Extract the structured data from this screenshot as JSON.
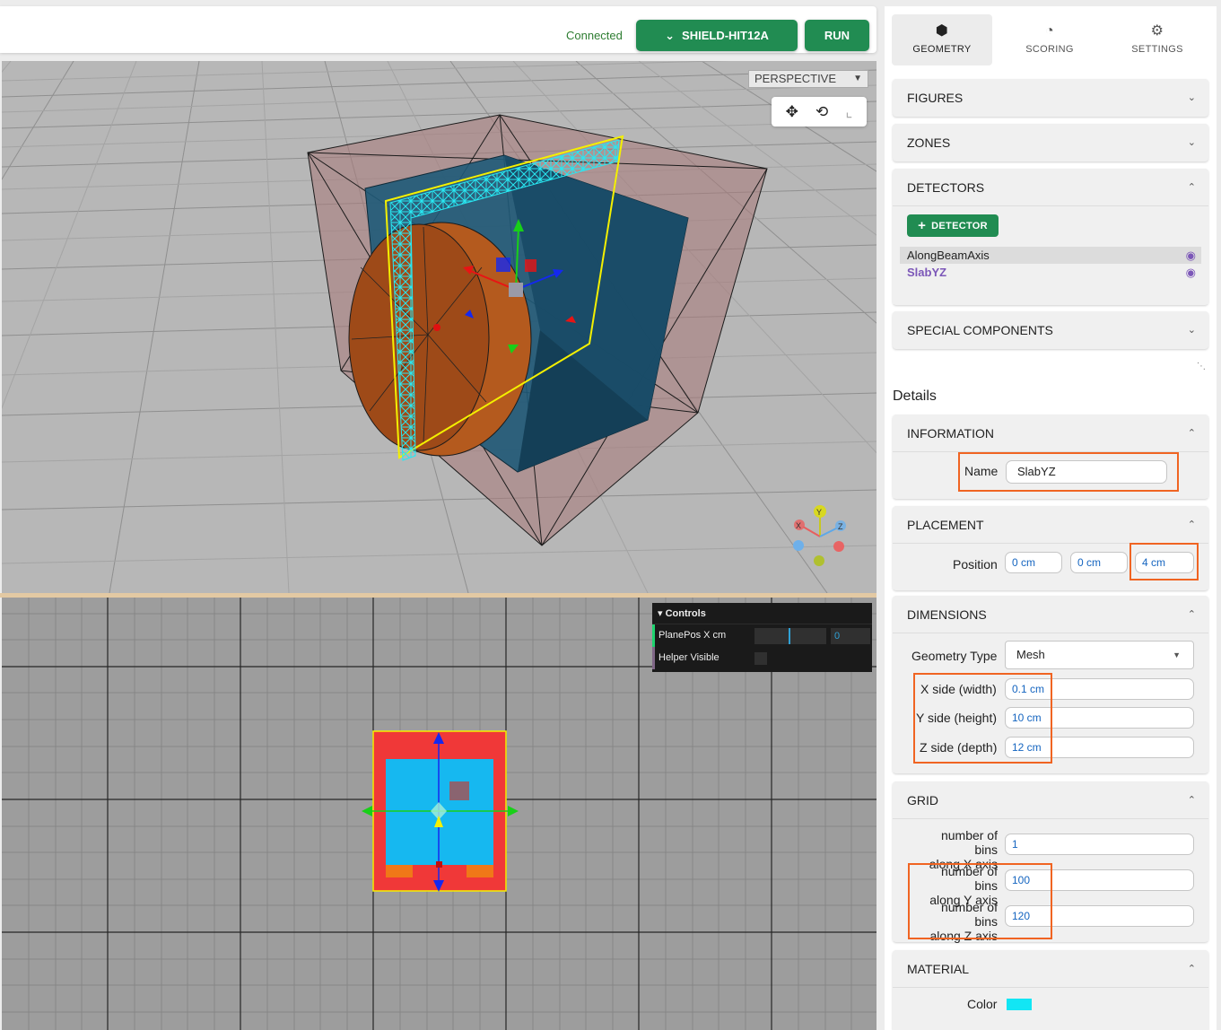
{
  "topbar": {
    "status": "Connected",
    "simulator_label": "SHIELD-HIT12A",
    "run_label": "RUN"
  },
  "viewport": {
    "camera_mode": "PERSPECTIVE",
    "axes": {
      "x": "X",
      "y": "Y",
      "z": "Z"
    }
  },
  "controls": {
    "title": "Controls",
    "plane_pos_label": "PlanePos X cm",
    "plane_pos_value": "0",
    "helper_visible_label": "Helper Visible"
  },
  "tabs": [
    {
      "label": "GEOMETRY",
      "icon": "cube-icon"
    },
    {
      "label": "SCORING",
      "icon": "speedometer-icon"
    },
    {
      "label": "SETTINGS",
      "icon": "gear-icon"
    }
  ],
  "sections": {
    "figures": "FIGURES",
    "zones": "ZONES",
    "detectors": "DETECTORS",
    "special_components": "SPECIAL COMPONENTS"
  },
  "detectors": {
    "add_label": "DETECTOR",
    "items": [
      "AlongBeamAxis",
      "SlabYZ"
    ]
  },
  "details": {
    "title": "Details",
    "information": {
      "title": "INFORMATION",
      "name_label": "Name",
      "name_value": "SlabYZ"
    },
    "placement": {
      "title": "PLACEMENT",
      "position_label": "Position",
      "x": "0 cm",
      "y": "0 cm",
      "z": "4 cm"
    },
    "dimensions": {
      "title": "DIMENSIONS",
      "geometry_type_label": "Geometry Type",
      "geometry_type_value": "Mesh",
      "x_label": "X side (width)",
      "x_value": "0.1 cm",
      "y_label": "Y side (height)",
      "y_value": "10 cm",
      "z_label": "Z side (depth)",
      "z_value": "12 cm"
    },
    "grid": {
      "title": "GRID",
      "x_label_1": "number of bins",
      "x_label_2": "along X axis",
      "x_value": "1",
      "y_label_1": "number of bins",
      "y_label_2": "along Y axis",
      "y_value": "100",
      "z_label_1": "number of bins",
      "z_label_2": "along Z axis",
      "z_value": "120"
    },
    "material": {
      "title": "MATERIAL",
      "color_label": "Color",
      "color_value": "#12e6f4"
    }
  }
}
